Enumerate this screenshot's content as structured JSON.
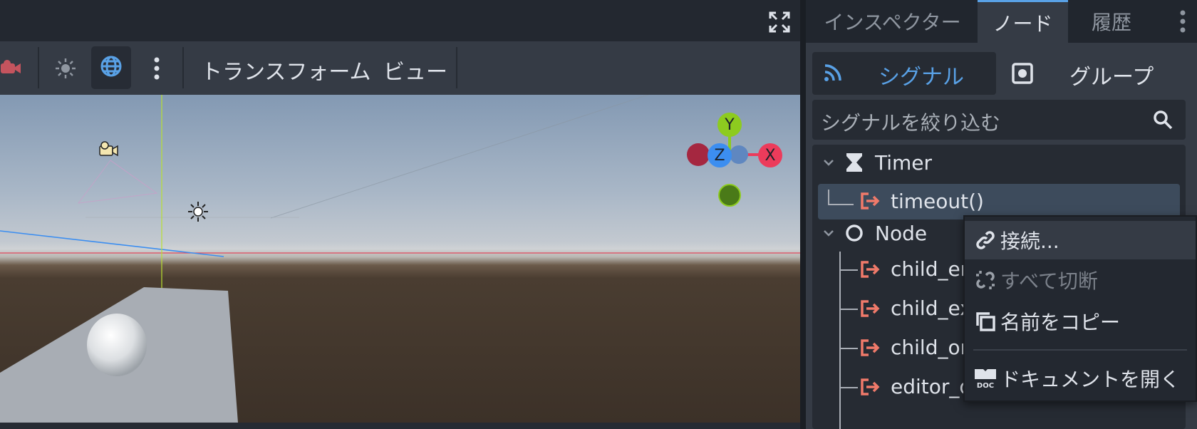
{
  "viewport": {
    "toolbar": {
      "transform_menu": "トランスフォーム",
      "view_menu": "ビュー"
    },
    "gizmo": {
      "y": "Y",
      "z": "Z",
      "x": "X"
    }
  },
  "dock": {
    "tabs": [
      {
        "label": "インスペクター",
        "active": false
      },
      {
        "label": "ノード",
        "active": true
      },
      {
        "label": "履歴",
        "active": false
      }
    ],
    "subtabs": {
      "signals": "シグナル",
      "groups": "グループ"
    },
    "filter_placeholder": "シグナルを絞り込む",
    "tree": {
      "timer": {
        "label": "Timer",
        "signals": [
          "timeout()"
        ]
      },
      "node": {
        "label": "Node",
        "signals": [
          "child_en",
          "child_ex",
          "child_or",
          "editor_description_changed(..."
        ]
      }
    }
  },
  "context_menu": {
    "items": [
      {
        "label": "接続...",
        "icon": "link-icon",
        "disabled": false
      },
      {
        "label": "すべて切断",
        "icon": "unlink-icon",
        "disabled": true
      },
      {
        "label": "名前をコピー",
        "icon": "copy-icon",
        "disabled": false
      },
      {
        "label": "ドキュメントを開く",
        "icon": "doc-icon",
        "disabled": false
      }
    ]
  },
  "colors": {
    "accent": "#59a1e6",
    "signal_icon": "#f07a6a",
    "axis_x": "#ec3b5b",
    "axis_y": "#8dcb1f",
    "axis_z": "#3c8ef0"
  }
}
